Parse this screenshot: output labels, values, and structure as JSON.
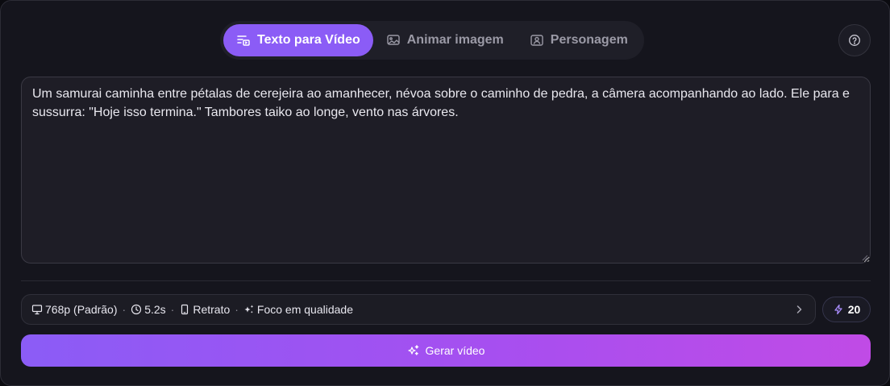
{
  "tabs": [
    {
      "label": "Texto para Vídeo",
      "icon": "text-to-video-icon",
      "active": true
    },
    {
      "label": "Animar imagem",
      "icon": "image-animate-icon",
      "active": false
    },
    {
      "label": "Personagem",
      "icon": "character-icon",
      "active": false
    }
  ],
  "help": {
    "icon": "help-circle-icon"
  },
  "prompt": {
    "value": "Um samurai caminha entre pétalas de cerejeira ao amanhecer, névoa sobre o caminho de pedra, a câmera acompanhando ao lado. Ele para e sussurra: \"Hoje isso termina.\" Tambores taiko ao longe, vento nas árvores."
  },
  "settings": {
    "resolution": "768p (Padrão)",
    "duration": "5.2s",
    "orientation": "Retrato",
    "mode": "Foco em qualidade",
    "separator": "·"
  },
  "credits": {
    "value": "20",
    "icon": "lightning-icon"
  },
  "generate": {
    "label": "Gerar vídeo",
    "icon": "sparkles-icon"
  },
  "colors": {
    "accent": "#8b5cf6",
    "gradient_end": "#c04be6",
    "background": "#15151d"
  }
}
